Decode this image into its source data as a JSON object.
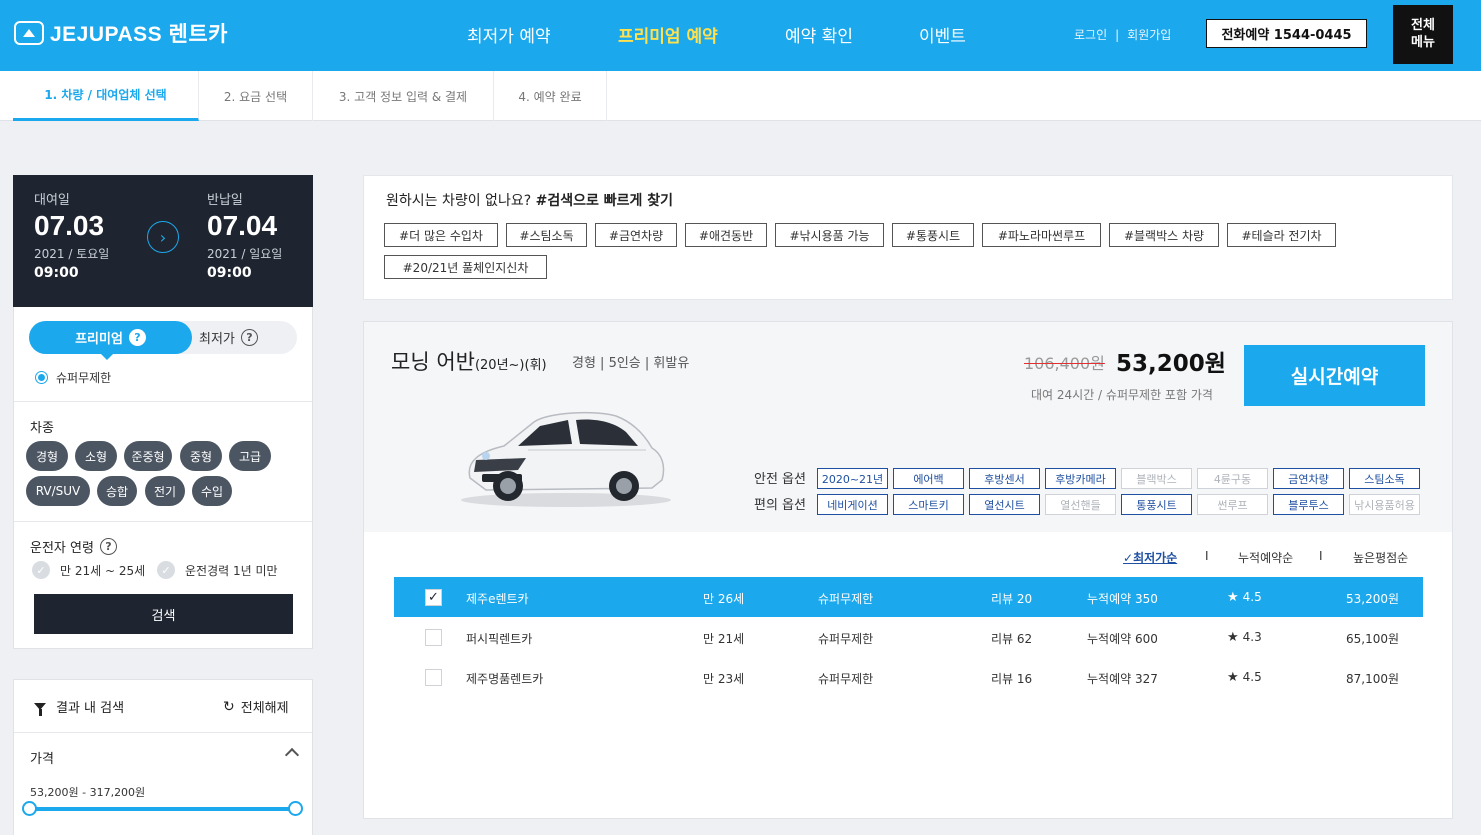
{
  "header": {
    "logo_text": "JEJUPASS 렌트카",
    "nav": [
      "최저가 예약",
      "프리미엄 예약",
      "예약 확인",
      "이벤트"
    ],
    "login": "로그인",
    "signup": "회원가입",
    "phone": "전화예약 1544-0445",
    "menu_line1": "전체",
    "menu_line2": "메뉴",
    "accent": "#1ba8ec",
    "nav_active_color": "#ffe14d"
  },
  "steps": [
    "1. 차량 / 대여업체 선택",
    "2. 요금 선택",
    "3. 고객 정보 입력 & 결제",
    "4. 예약 완료"
  ],
  "dates": {
    "pickup_label": "대여일",
    "pickup_date": "07.03",
    "pickup_day": "2021 / 토요일",
    "pickup_time": "09:00",
    "return_label": "반납일",
    "return_date": "07.04",
    "return_day": "2021 / 일요일",
    "return_time": "09:00"
  },
  "sidebar": {
    "toggle_on": "프리미엄",
    "toggle_off": "최저가",
    "radio_label": "슈퍼무제한",
    "car_type_title": "차종",
    "car_types": [
      "경형",
      "소형",
      "준중형",
      "중형",
      "고급",
      "RV/SUV",
      "승합",
      "전기",
      "수입"
    ],
    "driver_age_title": "운전자 연령",
    "age_option": "만 21세 ~ 25세",
    "exp_option": "운전경력 1년 미만",
    "search_button": "검색",
    "filter_title": "결과 내 검색",
    "reset_label": "전체해제",
    "price_title": "가격",
    "price_range": "53,200원  - 317,200원"
  },
  "quick_search": {
    "question": "원하시는 차량이 없나요? ",
    "question_bold": "#검색으로 빠르게 찾기",
    "tags": [
      "#더 많은 수입차",
      "#스팀소독",
      "#금연차량",
      "#애견동반",
      "#낚시용품 가능",
      "#통풍시트",
      "#파노라마썬루프",
      "#블랙박스 차량",
      "#테슬라 전기차",
      "#20/21년 풀체인지신차"
    ]
  },
  "car": {
    "name": "모닝 어반",
    "name_suffix": "(20년~)(휘)",
    "spec": "경형 | 5인승 | 휘발유",
    "price_old": "106,400원",
    "price_new": "53,200원",
    "price_note": "대여 24시간 / 슈퍼무제한 포함 가격",
    "reserve_button": "실시간예약",
    "safety_label": "안전 옵션",
    "convenience_label": "편의 옵션",
    "safety_options": [
      {
        "label": "2020~21년",
        "on": true
      },
      {
        "label": "에어백",
        "on": true
      },
      {
        "label": "후방센서",
        "on": true
      },
      {
        "label": "후방카메라",
        "on": true
      },
      {
        "label": "블랙박스",
        "on": false
      },
      {
        "label": "4륜구동",
        "on": false
      },
      {
        "label": "금연차량",
        "on": true
      },
      {
        "label": "스팀소독",
        "on": true
      }
    ],
    "convenience_options": [
      {
        "label": "네비게이션",
        "on": true
      },
      {
        "label": "스마트키",
        "on": true
      },
      {
        "label": "열선시트",
        "on": true
      },
      {
        "label": "열선핸들",
        "on": false
      },
      {
        "label": "통풍시트",
        "on": true
      },
      {
        "label": "썬루프",
        "on": false
      },
      {
        "label": "블루투스",
        "on": true
      },
      {
        "label": "낚시용품허용",
        "on": false
      }
    ]
  },
  "sort_options": [
    "최저가순",
    "누적예약순",
    "높은평점순"
  ],
  "sort_separator": "I",
  "companies": [
    {
      "name": "제주e렌트카",
      "age": "만 26세",
      "insurance": "슈퍼무제한",
      "reviews": "리뷰 20",
      "bookings": "누적예약 350",
      "rating": "4.5",
      "price": "53,200원",
      "selected": true
    },
    {
      "name": "퍼시픽렌트카",
      "age": "만 21세",
      "insurance": "슈퍼무제한",
      "reviews": "리뷰 62",
      "bookings": "누적예약 600",
      "rating": "4.3",
      "price": "65,100원",
      "selected": false
    },
    {
      "name": "제주명품렌트카",
      "age": "만 23세",
      "insurance": "슈퍼무제한",
      "reviews": "리뷰 16",
      "bookings": "누적예약 327",
      "rating": "4.5",
      "price": "87,100원",
      "selected": false
    }
  ]
}
